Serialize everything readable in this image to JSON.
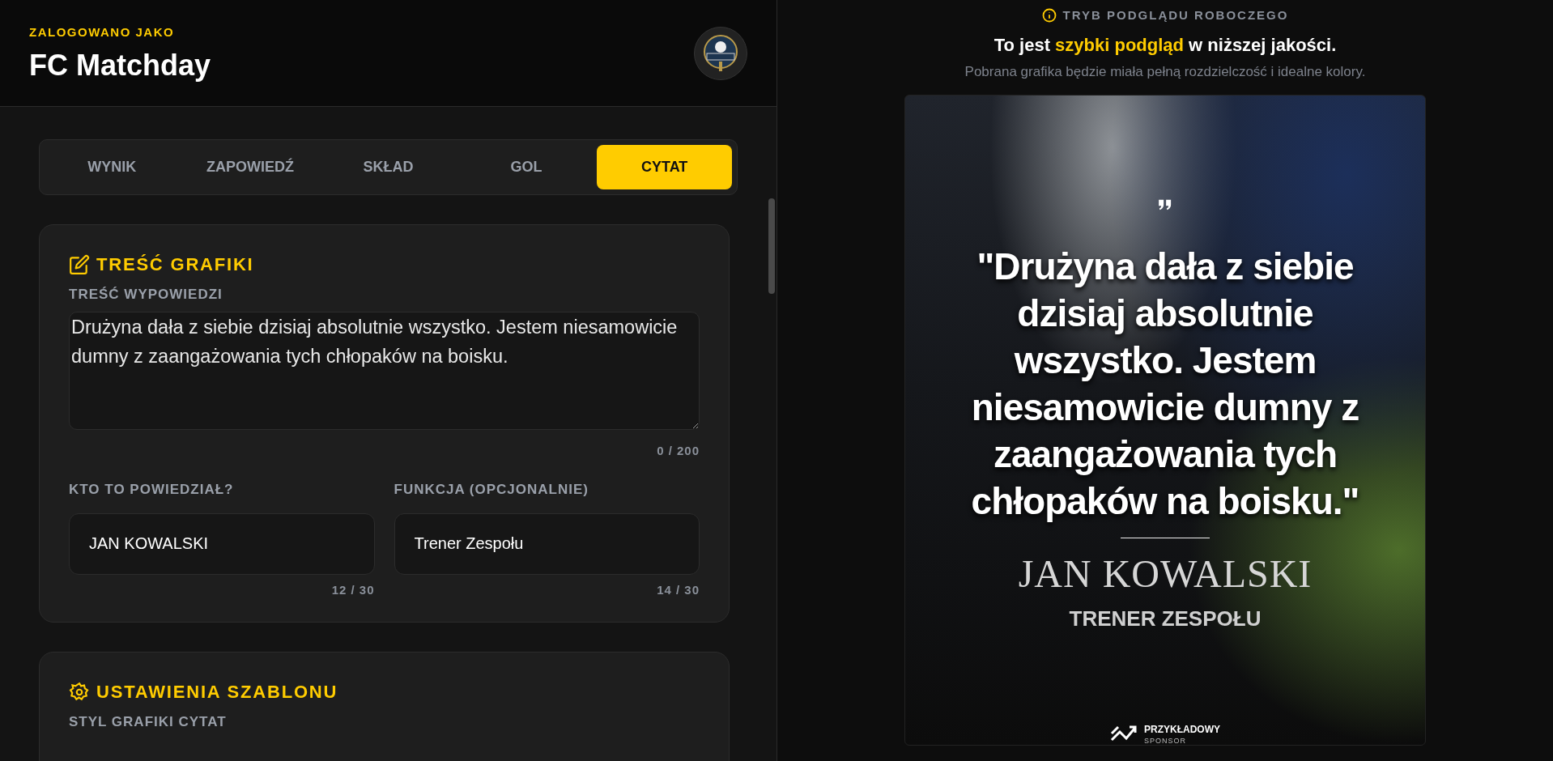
{
  "header": {
    "eyebrow": "ZALOGOWANO JAKO",
    "club_name": "FC Matchday"
  },
  "tabs": [
    {
      "label": "WYNIK",
      "selected": false
    },
    {
      "label": "ZAPOWIEDŹ",
      "selected": false
    },
    {
      "label": "SKŁAD",
      "selected": false
    },
    {
      "label": "GOL",
      "selected": false
    },
    {
      "label": "CYTAT",
      "selected": true
    }
  ],
  "content_card": {
    "title": "TREŚĆ GRAFIKI",
    "quote_field": {
      "label": "TREŚĆ WYPOWIEDZI",
      "value": "Drużyna dała z siebie dzisiaj absolutnie wszystko. Jestem niesamowicie dumny z zaangażowania tych chłopaków na boisku.",
      "counter": "0 / 200"
    },
    "fields": [
      {
        "label": "KTO TO POWIEDZIAŁ?",
        "value": "JAN KOWALSKI",
        "counter": "12 / 30"
      },
      {
        "label": "FUNKCJA (OPCJONALNIE)",
        "value": "Trener Zespołu",
        "counter": "14 / 30"
      }
    ]
  },
  "settings_card": {
    "title": "USTAWIENIA SZABLONU",
    "field_label": "STYL GRAFIKI CYTAT"
  },
  "preview": {
    "mode_label": "TRYB PODGLĄDU ROBOCZEGO",
    "headline": "To jest **szybki podgląd** w niższej jakości.",
    "note": "Pobrana grafika będzie miała pełną rozdzielczość i idealne kolory.",
    "poster": {
      "quote": "\"Drużyna dała z siebie dzisiaj absolutnie wszystko. Jestem niesamowicie dumny z zaangażowania tych chłopaków na boisku.\"",
      "name": "JAN KOWALSKI",
      "role": "TRENER ZESPOŁU",
      "sponsor": {
        "name": "PRZYKŁADOWY",
        "tagline": "SPONSOR"
      }
    }
  }
}
